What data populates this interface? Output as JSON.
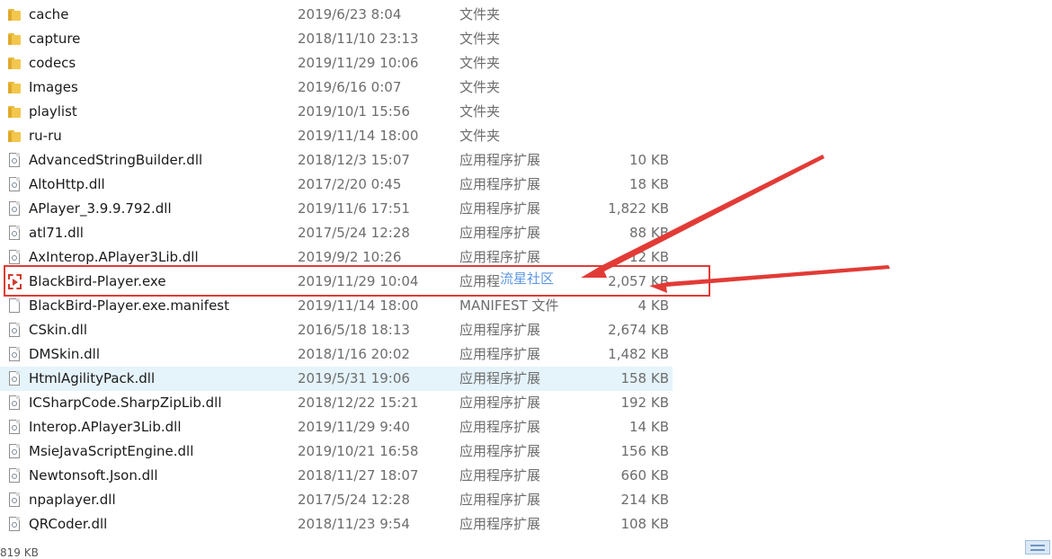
{
  "files": [
    {
      "name": "cache",
      "date": "2019/6/23 8:04",
      "type": "文件夹",
      "size": "",
      "icon": "folder-icon"
    },
    {
      "name": "capture",
      "date": "2018/11/10 23:13",
      "type": "文件夹",
      "size": "",
      "icon": "folder-icon"
    },
    {
      "name": "codecs",
      "date": "2019/11/29 10:06",
      "type": "文件夹",
      "size": "",
      "icon": "folder-icon"
    },
    {
      "name": "Images",
      "date": "2019/6/16 0:07",
      "type": "文件夹",
      "size": "",
      "icon": "folder-icon"
    },
    {
      "name": "playlist",
      "date": "2019/10/1 15:56",
      "type": "文件夹",
      "size": "",
      "icon": "folder-icon"
    },
    {
      "name": "ru-ru",
      "date": "2019/11/14 18:00",
      "type": "文件夹",
      "size": "",
      "icon": "folder-icon"
    },
    {
      "name": "AdvancedStringBuilder.dll",
      "date": "2018/12/3 15:07",
      "type": "应用程序扩展",
      "size": "10 KB",
      "icon": "dll-file-icon"
    },
    {
      "name": "AltoHttp.dll",
      "date": "2017/2/20 0:45",
      "type": "应用程序扩展",
      "size": "18 KB",
      "icon": "dll-file-icon"
    },
    {
      "name": "APlayer_3.9.9.792.dll",
      "date": "2019/11/6 17:51",
      "type": "应用程序扩展",
      "size": "1,822 KB",
      "icon": "dll-file-icon"
    },
    {
      "name": "atl71.dll",
      "date": "2017/5/24 12:28",
      "type": "应用程序扩展",
      "size": "88 KB",
      "icon": "dll-file-icon"
    },
    {
      "name": "AxInterop.APlayer3Lib.dll",
      "date": "2019/9/2 10:26",
      "type": "应用程序扩展",
      "size": "12 KB",
      "icon": "dll-file-icon"
    },
    {
      "name": "BlackBird-Player.exe",
      "date": "2019/11/29 10:04",
      "type": "应用程",
      "size": "2,057 KB",
      "icon": "exe-app-icon"
    },
    {
      "name": "BlackBird-Player.exe.manifest",
      "date": "2019/11/14 18:00",
      "type": "MANIFEST 文件",
      "size": "4 KB",
      "icon": "manifest-file-icon"
    },
    {
      "name": "CSkin.dll",
      "date": "2016/5/18 18:13",
      "type": "应用程序扩展",
      "size": "2,674 KB",
      "icon": "dll-file-icon"
    },
    {
      "name": "DMSkin.dll",
      "date": "2018/1/16 20:02",
      "type": "应用程序扩展",
      "size": "1,482 KB",
      "icon": "dll-file-icon"
    },
    {
      "name": "HtmlAgilityPack.dll",
      "date": "2019/5/31 19:06",
      "type": "应用程序扩展",
      "size": "158 KB",
      "icon": "dll-file-icon"
    },
    {
      "name": "ICSharpCode.SharpZipLib.dll",
      "date": "2018/12/22 15:21",
      "type": "应用程序扩展",
      "size": "192 KB",
      "icon": "dll-file-icon"
    },
    {
      "name": "Interop.APlayer3Lib.dll",
      "date": "2019/11/29 9:40",
      "type": "应用程序扩展",
      "size": "14 KB",
      "icon": "dll-file-icon"
    },
    {
      "name": "MsieJavaScriptEngine.dll",
      "date": "2019/10/21 16:58",
      "type": "应用程序扩展",
      "size": "156 KB",
      "icon": "dll-file-icon"
    },
    {
      "name": "Newtonsoft.Json.dll",
      "date": "2018/11/27 18:07",
      "type": "应用程序扩展",
      "size": "660 KB",
      "icon": "dll-file-icon"
    },
    {
      "name": "npaplayer.dll",
      "date": "2017/5/24 12:28",
      "type": "应用程序扩展",
      "size": "214 KB",
      "icon": "dll-file-icon"
    },
    {
      "name": "QRCoder.dll",
      "date": "2018/11/23 9:54",
      "type": "应用程序扩展",
      "size": "108 KB",
      "icon": "dll-file-icon"
    }
  ],
  "annotation": {
    "watermark_text": "流星社区",
    "highlight_color": "#e23b36"
  },
  "status_bar": {
    "selected_size_fragment": "819 KB"
  },
  "colors": {
    "hover_row": "#e5f3fb",
    "folder": "#f3c74e",
    "secondary_text": "#6d6d6d"
  }
}
